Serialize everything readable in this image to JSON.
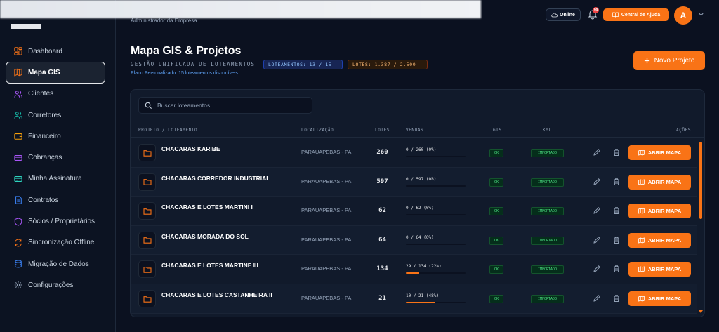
{
  "user": {
    "role": "Administrador da Empresa",
    "avatar_initial": "A"
  },
  "topbar": {
    "online_label": "Online",
    "notification_count": "99",
    "help_label": "Central de Ajuda"
  },
  "sidebar": {
    "items": [
      {
        "label": "Dashboard",
        "icon": "dashboard-icon",
        "color": "#f97316"
      },
      {
        "label": "Mapa GIS",
        "icon": "map-icon",
        "color": "#f97316",
        "active": true
      },
      {
        "label": "Clientes",
        "icon": "users-icon",
        "color": "#a855f7"
      },
      {
        "label": "Corretores",
        "icon": "user-group-icon",
        "color": "#14b8a6"
      },
      {
        "label": "Financeiro",
        "icon": "wallet-icon",
        "color": "#f59e0b"
      },
      {
        "label": "Cobranças",
        "icon": "card-icon",
        "color": "#a855f7"
      },
      {
        "label": "Minha Assinatura",
        "icon": "subscription-icon",
        "color": "#2dd4bf"
      },
      {
        "label": "Contratos",
        "icon": "document-icon",
        "color": "#3b82f6"
      },
      {
        "label": "Sócios / Proprietários",
        "icon": "shield-icon",
        "color": "#a855f7"
      },
      {
        "label": "Sincronização Offline",
        "icon": "sync-icon",
        "color": "#f97316"
      },
      {
        "label": "Migração de Dados",
        "icon": "database-icon",
        "color": "#3b82f6"
      },
      {
        "label": "Configurações",
        "icon": "gear-icon",
        "color": "#94a3b8"
      }
    ]
  },
  "page": {
    "title": "Mapa GIS & Projetos",
    "subtitle": "GESTÃO UNIFICADA DE LOTEAMENTOS",
    "badge_loteamentos": "LOTEAMENTOS: 13 / 15",
    "badge_lotes": "LOTES: 1.387 / 2.500",
    "plan_note": "Plano Personalizado: 15 loteamentos disponíveis",
    "new_project_label": "Novo Projeto"
  },
  "search": {
    "placeholder": "Buscar loteamentos..."
  },
  "table": {
    "headers": {
      "project": "PROJETO / LOTEAMENTO",
      "location": "LOCALIZAÇÃO",
      "lots": "LOTES",
      "sales": "VENDAS",
      "gis": "GIS",
      "kml": "KML",
      "actions": "AÇÕES"
    },
    "open_label": "ABRIR MAPA",
    "rows": [
      {
        "name": "CHACARAS KARIBE",
        "location": "PARAUAPEBAS - PA",
        "lots": "260",
        "sales": "0 / 260 (0%)",
        "progress": 0,
        "gis": "OK",
        "kml": "IMPORTADO"
      },
      {
        "name": "CHACARAS CORREDOR INDUSTRIAL",
        "location": "PARAUAPEBAS - PA",
        "lots": "597",
        "sales": "0 / 597 (0%)",
        "progress": 0,
        "gis": "OK",
        "kml": "IMPORTADO"
      },
      {
        "name": "CHACARAS E LOTES MARTINI I",
        "location": "PARAUAPEBAS - PA",
        "lots": "62",
        "sales": "0 / 62 (0%)",
        "progress": 0,
        "gis": "OK",
        "kml": "IMPORTADO"
      },
      {
        "name": "CHACARAS MORADA DO SOL",
        "location": "PARAUAPEBAS - PA",
        "lots": "64",
        "sales": "0 / 64 (0%)",
        "progress": 0,
        "gis": "OK",
        "kml": "IMPORTADO"
      },
      {
        "name": "CHACARAS E LOTES MARTINE III",
        "location": "PARAUAPEBAS - PA",
        "lots": "134",
        "sales": "29 / 134 (22%)",
        "progress": 22,
        "gis": "OK",
        "kml": "IMPORTADO"
      },
      {
        "name": "CHACARAS E LOTES CASTANHEIRA II",
        "location": "PARAUAPEBAS - PA",
        "lots": "21",
        "sales": "10 / 21 (48%)",
        "progress": 48,
        "gis": "OK",
        "kml": "IMPORTADO"
      }
    ]
  }
}
